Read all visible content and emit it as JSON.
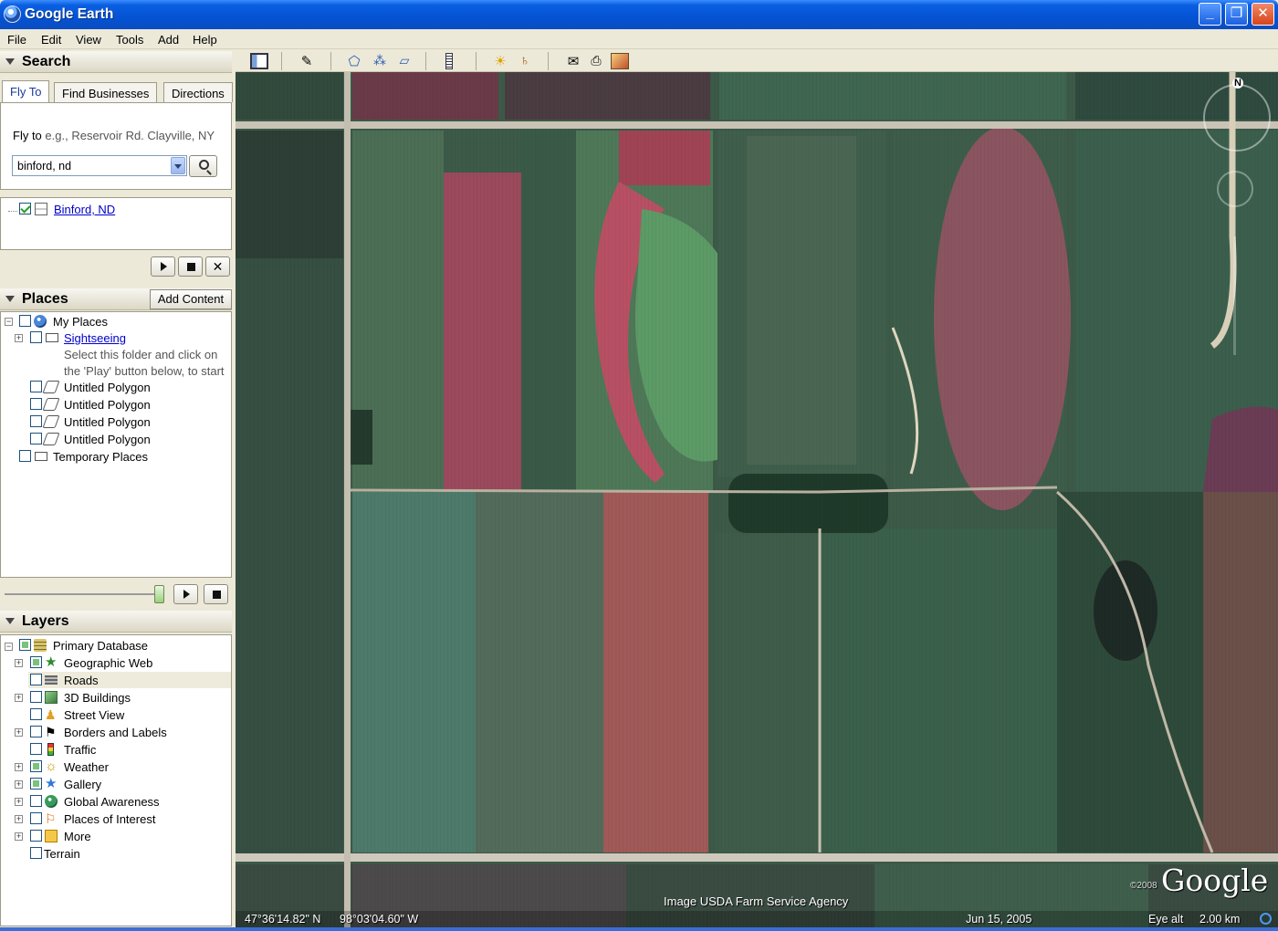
{
  "window": {
    "title": "Google Earth",
    "minimize": "_",
    "maximize": "❐",
    "close": "✕"
  },
  "menu": [
    "File",
    "Edit",
    "View",
    "Tools",
    "Add",
    "Help"
  ],
  "search": {
    "header": "Search",
    "tabs": [
      "Fly To",
      "Find Businesses",
      "Directions"
    ],
    "fly_label": "Fly to",
    "fly_hint": "e.g., Reservoir Rd. Clayville, NY",
    "query": "binford, nd",
    "result": "Binford, ND"
  },
  "places": {
    "header": "Places",
    "add_content": "Add Content",
    "my_places": "My Places",
    "sightseeing": "Sightseeing",
    "hint_line1": "Select this folder and click on",
    "hint_line2": "the 'Play' button below, to start",
    "polygons": [
      "Untitled Polygon",
      "Untitled Polygon",
      "Untitled Polygon",
      "Untitled Polygon"
    ],
    "temporary": "Temporary Places"
  },
  "layers": {
    "header": "Layers",
    "root": "Primary Database",
    "items": [
      "Geographic Web",
      "Roads",
      "3D Buildings",
      "Street View",
      "Borders and Labels",
      "Traffic",
      "Weather",
      "Gallery",
      "Global Awareness",
      "Places of Interest",
      "More"
    ],
    "terrain": "Terrain"
  },
  "map": {
    "compass_n": "N",
    "credit": "Image USDA Farm Service Agency",
    "copyright": "©2008",
    "logo": "Google",
    "lat": "47°36'14.82\" N",
    "lon": "98°03'04.60\" W",
    "date": "Jun 15, 2005",
    "eye_label": "Eye alt",
    "eye_value": "2.00 km"
  }
}
